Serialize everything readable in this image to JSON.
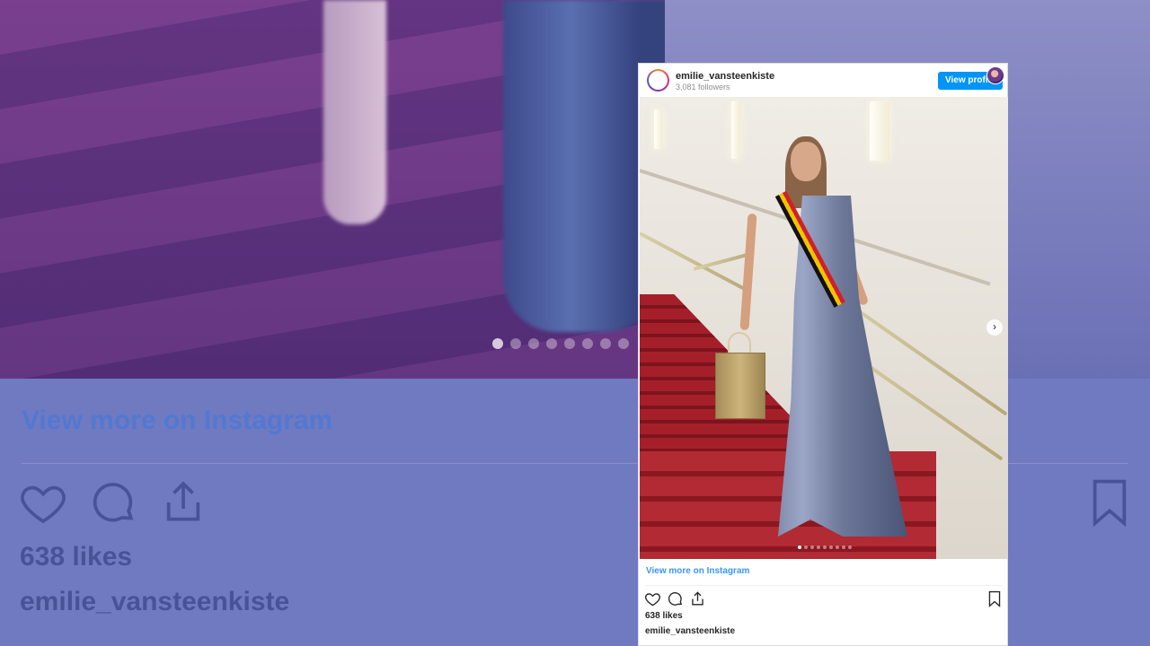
{
  "background": {
    "view_more_text": "View more on Instagram",
    "likes_text": "638 likes",
    "username_text": "emilie_vansteenkiste",
    "dots_count": 8,
    "active_dot": 0
  },
  "embed": {
    "header": {
      "username": "emilie_vansteenkiste",
      "followers": "3,081 followers",
      "view_profile_label": "View profile"
    },
    "photo": {
      "next_icon": "chevron-right-icon",
      "dots_count": 9,
      "active_dot": 0
    },
    "footer": {
      "view_more_text": "View more on Instagram",
      "likes_text": "638 likes",
      "caption_username": "emilie_vansteenkiste"
    },
    "icons": [
      "heart-icon",
      "comment-icon",
      "share-icon",
      "bookmark-icon"
    ],
    "accent_color": "#0095f6",
    "link_color": "#3897f0"
  }
}
